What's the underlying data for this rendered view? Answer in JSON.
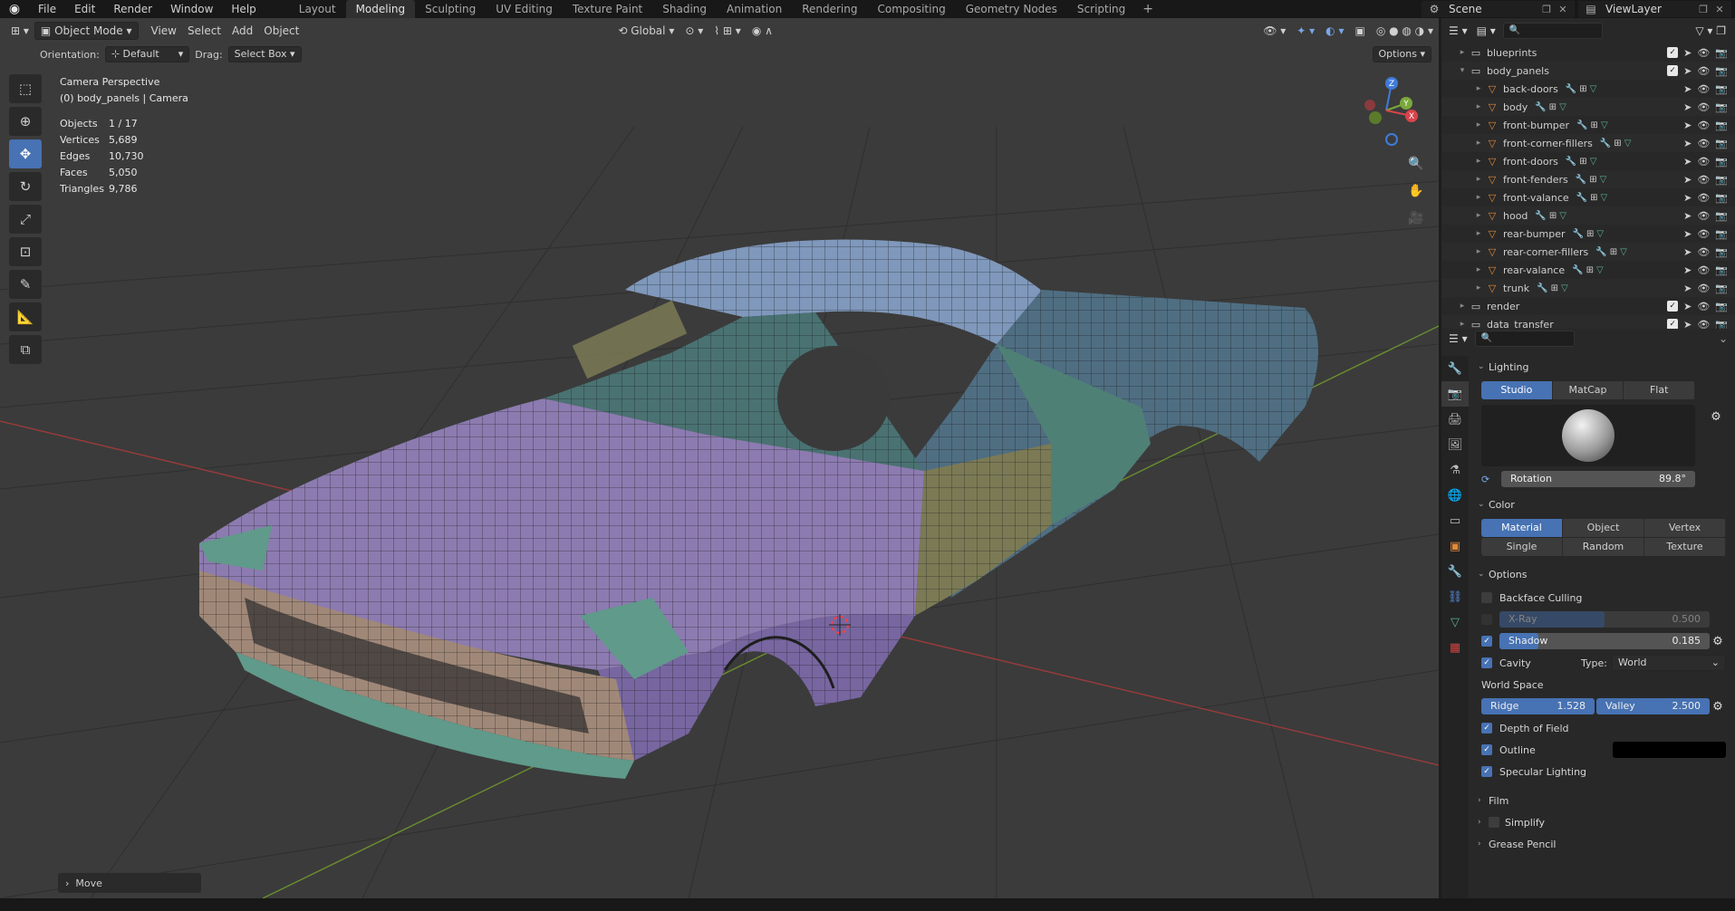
{
  "topbar": {
    "menu": [
      "File",
      "Edit",
      "Render",
      "Window",
      "Help"
    ],
    "workspaces": [
      "Layout",
      "Modeling",
      "Sculpting",
      "UV Editing",
      "Texture Paint",
      "Shading",
      "Animation",
      "Rendering",
      "Compositing",
      "Geometry Nodes",
      "Scripting"
    ],
    "active_workspace": "Modeling",
    "scene": "Scene",
    "view_layer": "ViewLayer"
  },
  "viewport": {
    "mode": "Object Mode",
    "menus": [
      "View",
      "Select",
      "Add",
      "Object"
    ],
    "transform_orientation": "Global",
    "orientation_label": "Orientation:",
    "orientation_value": "Default",
    "drag_label": "Drag:",
    "drag_value": "Select Box",
    "options_label": "Options",
    "camera_title": "Camera Perspective",
    "camera_subtitle": "(0) body_panels | Camera",
    "stats": [
      {
        "label": "Objects",
        "value": "1 / 17"
      },
      {
        "label": "Vertices",
        "value": "5,689"
      },
      {
        "label": "Edges",
        "value": "10,730"
      },
      {
        "label": "Faces",
        "value": "5,050"
      },
      {
        "label": "Triangles",
        "value": "9,786"
      }
    ],
    "last_operator": "Move",
    "gizmo_axes": [
      "Z",
      "Y",
      "X"
    ]
  },
  "outliner": {
    "items": [
      {
        "name": "blueprints",
        "indent": 1,
        "icon": "collection"
      },
      {
        "name": "body_panels",
        "indent": 1,
        "icon": "collection"
      },
      {
        "name": "back-doors",
        "indent": 2,
        "icon": "mesh"
      },
      {
        "name": "body",
        "indent": 2,
        "icon": "mesh"
      },
      {
        "name": "front-bumper",
        "indent": 2,
        "icon": "mesh"
      },
      {
        "name": "front-corner-fillers",
        "indent": 2,
        "icon": "mesh"
      },
      {
        "name": "front-doors",
        "indent": 2,
        "icon": "mesh"
      },
      {
        "name": "front-fenders",
        "indent": 2,
        "icon": "mesh"
      },
      {
        "name": "front-valance",
        "indent": 2,
        "icon": "mesh"
      },
      {
        "name": "hood",
        "indent": 2,
        "icon": "mesh"
      },
      {
        "name": "rear-bumper",
        "indent": 2,
        "icon": "mesh"
      },
      {
        "name": "rear-corner-fillers",
        "indent": 2,
        "icon": "mesh"
      },
      {
        "name": "rear-valance",
        "indent": 2,
        "icon": "mesh"
      },
      {
        "name": "trunk",
        "indent": 2,
        "icon": "mesh"
      },
      {
        "name": "render",
        "indent": 1,
        "icon": "collection"
      },
      {
        "name": "data_transfer",
        "indent": 1,
        "icon": "collection"
      }
    ]
  },
  "properties": {
    "lighting": {
      "title": "Lighting",
      "modes": [
        "Studio",
        "MatCap",
        "Flat"
      ],
      "active": "Studio",
      "rotation_label": "Rotation",
      "rotation_value": "89.8°",
      "rotation_fraction": 0.5
    },
    "color": {
      "title": "Color",
      "row1": [
        "Material",
        "Object",
        "Vertex"
      ],
      "row2": [
        "Single",
        "Random",
        "Texture"
      ],
      "active": "Material"
    },
    "options": {
      "title": "Options",
      "backface": "Backface Culling",
      "xray_label": "X-Ray",
      "xray_value": "0.500",
      "xray_fraction": 0.5,
      "shadow_label": "Shadow",
      "shadow_value": "0.185",
      "shadow_fraction": 0.185,
      "cavity": "Cavity",
      "type_label": "Type:",
      "type_value": "World",
      "world_space": "World Space",
      "ridge_label": "Ridge",
      "ridge_value": "1.528",
      "valley_label": "Valley",
      "valley_value": "2.500",
      "dof": "Depth of Field",
      "outline": "Outline",
      "specular": "Specular Lighting"
    },
    "collapsed": [
      "Film",
      "Simplify",
      "Grease Pencil"
    ]
  },
  "colors": {
    "accent": "#4772b3",
    "hood": "#8c7bb0",
    "roof": "#7f98bb",
    "fender_teal": "#5f9a8a",
    "door_olive": "#7b7a55",
    "door_teal": "#4f8076",
    "bumper_tan": "#a08878",
    "mesh_orange": "#e08a3a"
  }
}
